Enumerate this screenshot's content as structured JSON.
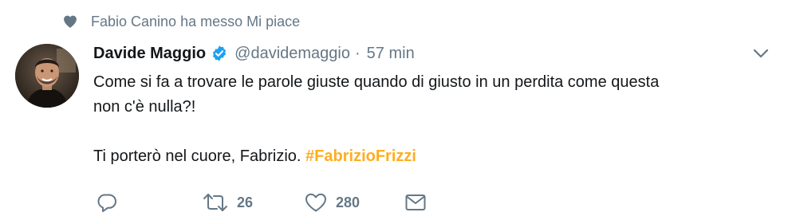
{
  "context": {
    "icon": "heart-icon",
    "text": "Fabio Canino ha messo Mi piace"
  },
  "author": {
    "name": "Davide Maggio",
    "handle": "@davidemaggio",
    "separator": "·",
    "time": "57 min",
    "verified": true
  },
  "tweet": {
    "line1": "Come si fa a trovare le parole giuste quando di giusto in un perdita come questa",
    "line2": "non c'è nulla?!",
    "line3_prefix": "Ti porterò nel cuore, Fabrizio. ",
    "hashtag": "#FabrizioFrizzi"
  },
  "actions": {
    "reply_count": "",
    "retweet_count": "26",
    "like_count": "280"
  },
  "colors": {
    "accent": "#ffad1f",
    "verified": "#1da1f2",
    "muted": "#657786",
    "text": "#14171a"
  }
}
